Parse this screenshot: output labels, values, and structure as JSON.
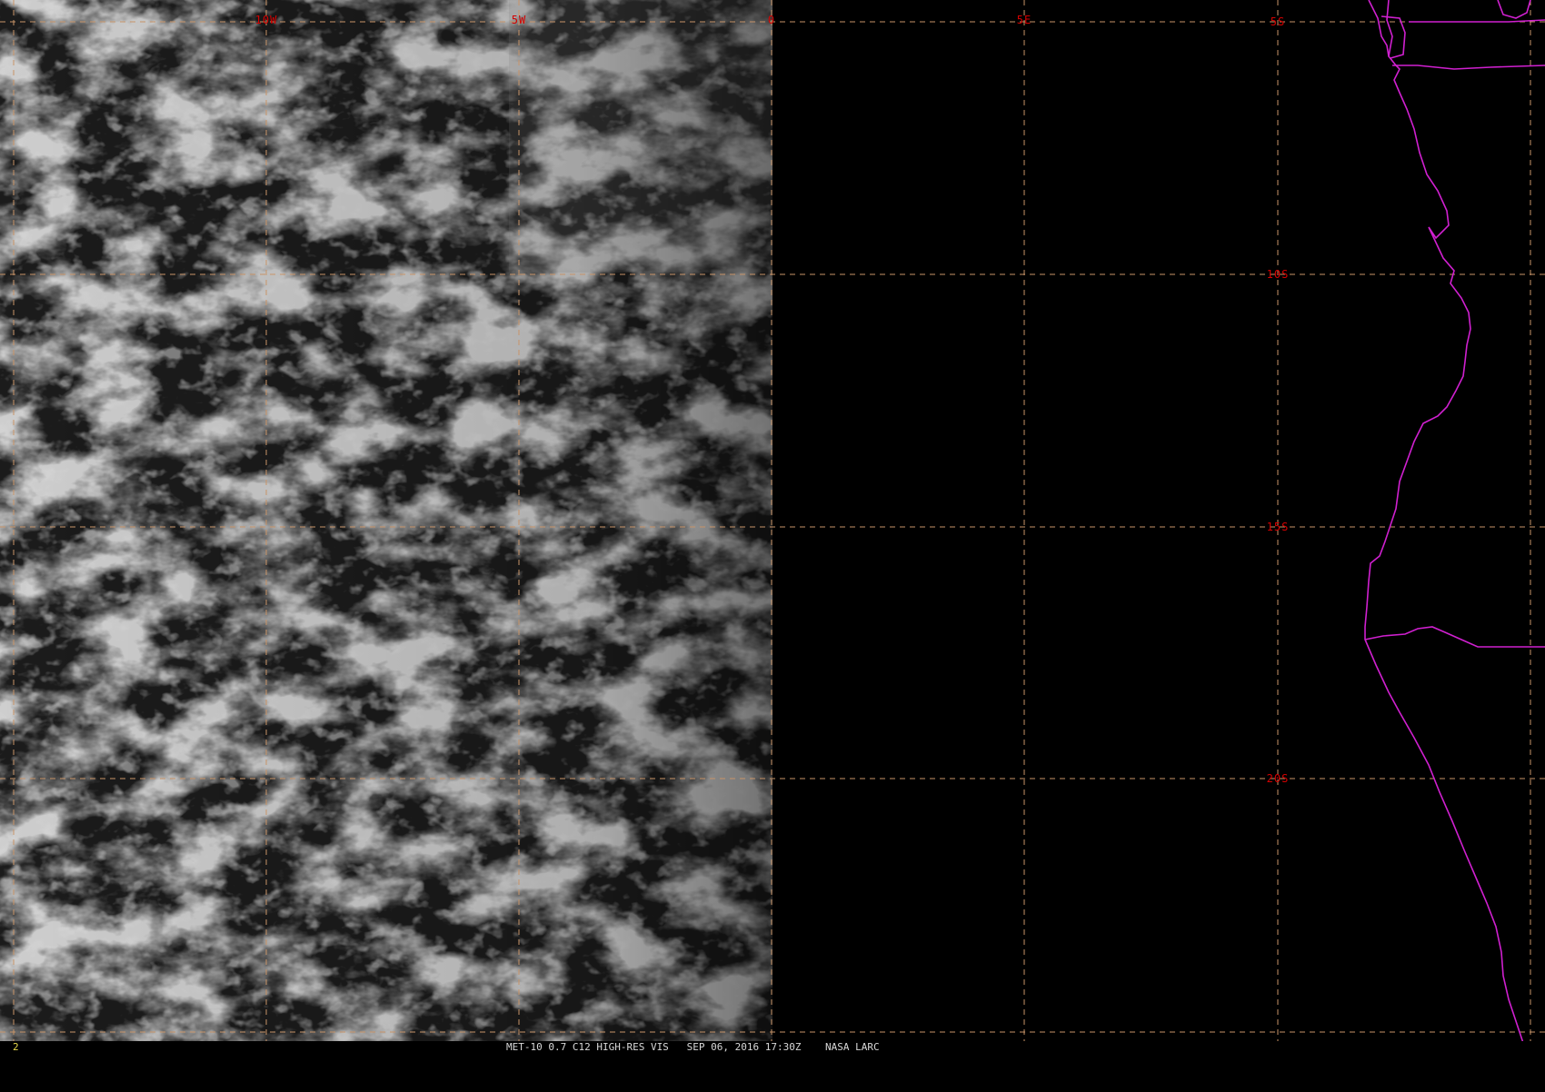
{
  "image": {
    "satellite": "MET-10",
    "caption": "MET-10 0.7 C12 HIGH-RES VIS   SEP 06, 2016 17:30Z    NASA LARC",
    "frame_number": "2"
  },
  "grid": {
    "longitude_labels": [
      "10W",
      "5W",
      "0",
      "5E"
    ],
    "latitude_labels": [
      "5S",
      "10S",
      "15S",
      "20S"
    ],
    "line_color": "#c89468",
    "label_color": "#d40000"
  },
  "map": {
    "coastline_color": "#d020d0",
    "daylight_region": "west of 0"
  }
}
